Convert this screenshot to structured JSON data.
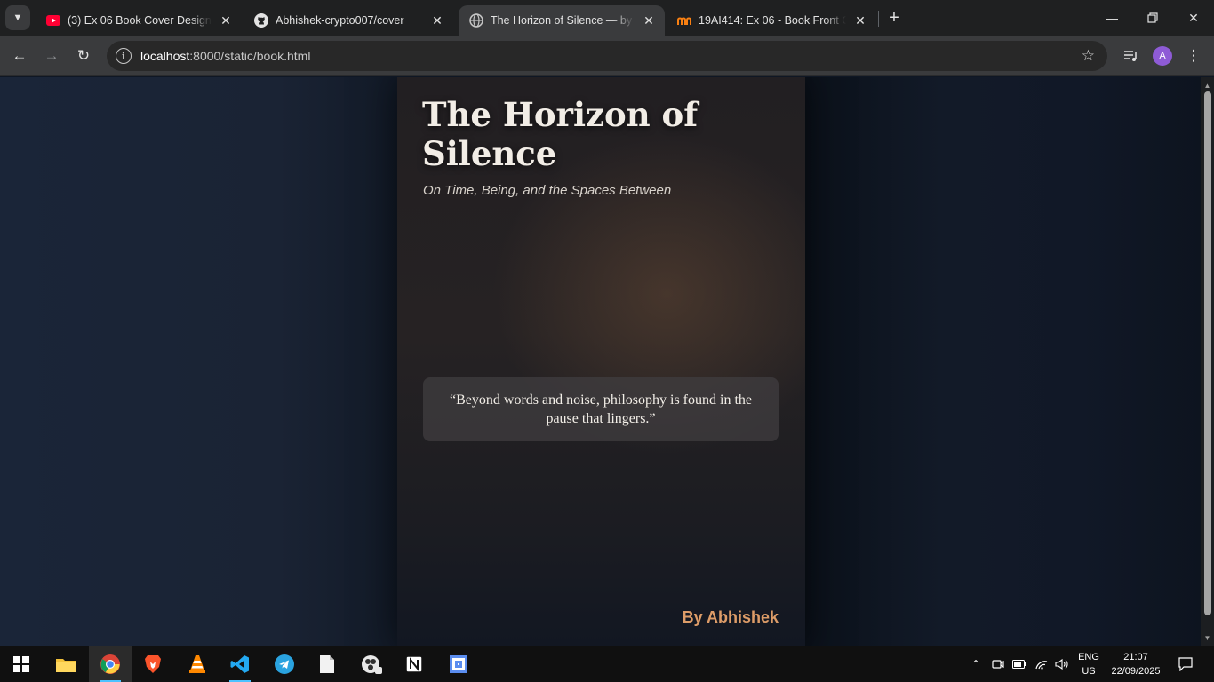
{
  "browser": {
    "tabs": [
      {
        "title": "(3) Ex 06 Book Cover Design using",
        "icon": "youtube-icon",
        "active": false
      },
      {
        "title": "Abhishek-crypto007/cover",
        "icon": "github-icon",
        "active": false
      },
      {
        "title": "The Horizon of Silence — by Ho",
        "icon": "globe-icon",
        "active": true
      },
      {
        "title": "19AI414: Ex 06 - Book Front Cov",
        "icon": "moodle-icon",
        "active": false
      }
    ],
    "url_host": "localhost",
    "url_rest": ":8000/static/book.html",
    "profile_initial": "A"
  },
  "book": {
    "title": "The Horizon of Silence",
    "subtitle": "On Time, Being, and the Spaces Between",
    "quote": "“Beyond words and noise, philosophy is found in the pause that lingers.”",
    "author": "By Abhishek",
    "colors": {
      "title": "#f2ede6",
      "author": "#dd9c68",
      "background": "#111a27"
    }
  },
  "taskbar": {
    "apps": [
      "windows-start-icon",
      "file-explorer-icon",
      "chrome-icon",
      "brave-icon",
      "vlc-icon",
      "vscode-icon",
      "telegram-icon",
      "notepad-icon",
      "obs-icon",
      "notion-icon",
      "app-icon"
    ],
    "language_top": "ENG",
    "language_bottom": "US",
    "time": "21:07",
    "date": "22/09/2025"
  }
}
